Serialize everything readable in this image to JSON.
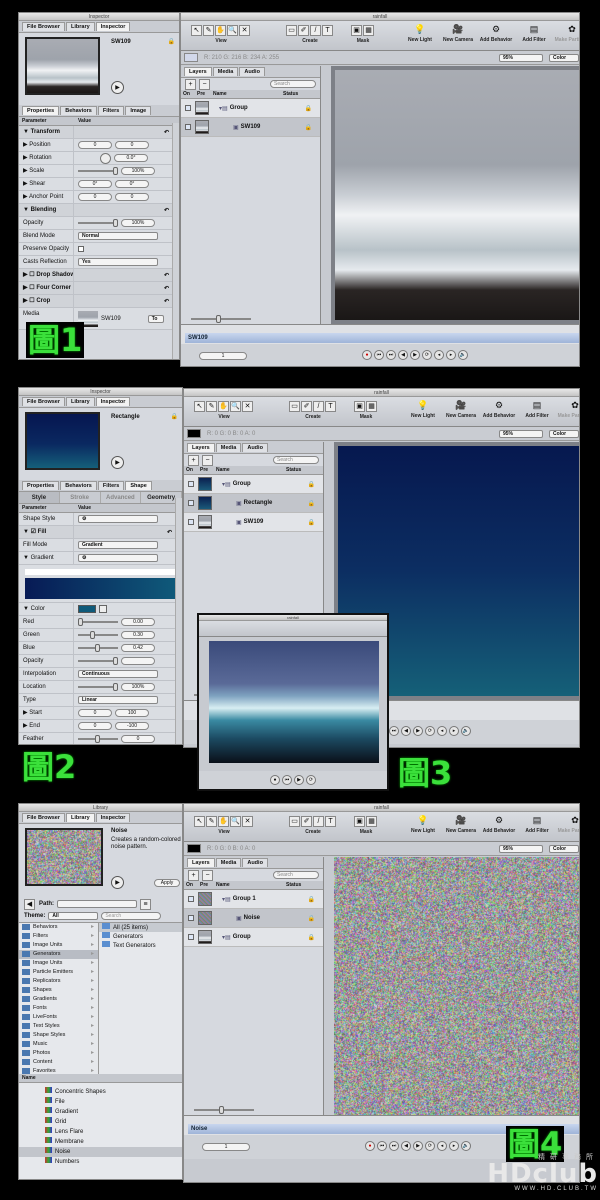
{
  "figure_labels": {
    "fig1": "圖1",
    "fig2": "圖2",
    "fig3": "圖3",
    "fig4": "圖4"
  },
  "watermark": {
    "brand": "HDclub",
    "subtitle": "精研事務所",
    "url": "WWW.HD.CLUB.TW"
  },
  "window": {
    "title": "rainfall",
    "tool_groups": [
      "View",
      "Create",
      "Mask"
    ],
    "actions": [
      "New Light",
      "New Camera",
      "Add Behavior",
      "Add Filter",
      "Make Particles"
    ],
    "zoom": "95%",
    "view_mode": "Color",
    "tabs": [
      "Layers",
      "Media",
      "Audio"
    ],
    "search_placeholder": "Search",
    "columns": [
      "On",
      "Pre",
      "Name",
      "Status"
    ],
    "frame": "1"
  },
  "fig1": {
    "inspector": {
      "title": "Inspector",
      "tabs": [
        "File Browser",
        "Library",
        "Inspector"
      ],
      "preview_name": "SW109",
      "subtabs": [
        "Properties",
        "Behaviors",
        "Filters",
        "Image"
      ],
      "header": [
        "Parameter",
        "Value"
      ],
      "rows": [
        {
          "label": "▼ Transform",
          "kind": "sec",
          "values": []
        },
        {
          "label": "▶ Position",
          "kind": "pair",
          "values": [
            "0",
            "0"
          ]
        },
        {
          "label": "▶ Rotation",
          "kind": "dial",
          "values": [
            "0.0°"
          ]
        },
        {
          "label": "▶ Scale",
          "kind": "slider",
          "values": [
            "100%"
          ]
        },
        {
          "label": "▶ Shear",
          "kind": "pair",
          "values": [
            "0°",
            "0°"
          ]
        },
        {
          "label": "▶ Anchor Point",
          "kind": "pair",
          "values": [
            "0",
            "0"
          ]
        },
        {
          "label": "▼ Blending",
          "kind": "sec",
          "values": []
        },
        {
          "label": "Opacity",
          "kind": "slider",
          "values": [
            "100%"
          ]
        },
        {
          "label": "Blend Mode",
          "kind": "select",
          "values": [
            "Normal"
          ]
        },
        {
          "label": "Preserve Opacity",
          "kind": "check",
          "values": []
        },
        {
          "label": "Casts Reflection",
          "kind": "select",
          "values": [
            "Yes"
          ]
        },
        {
          "label": "▶ ☐ Drop Shadow",
          "kind": "sec",
          "values": []
        },
        {
          "label": "▶ ☐ Four Corner",
          "kind": "sec",
          "values": []
        },
        {
          "label": "▶ ☐ Crop",
          "kind": "sec",
          "values": []
        },
        {
          "label": "Media",
          "kind": "media",
          "values": [
            "SW109",
            "To"
          ]
        }
      ]
    },
    "color_readout": "R: 210  G: 216  B: 234  A: 255",
    "layers": [
      {
        "name": "Group",
        "level": 0,
        "selected": false
      },
      {
        "name": "SW109",
        "level": 1,
        "selected": true
      }
    ],
    "track": "SW109"
  },
  "fig2": {
    "inspector": {
      "title": "Inspector",
      "tabs": [
        "File Browser",
        "Library",
        "Inspector"
      ],
      "preview_name": "Rectangle",
      "subtabs": [
        "Properties",
        "Behaviors",
        "Filters",
        "Shape"
      ],
      "shape_tabs": [
        "Style",
        "Stroke",
        "Advanced",
        "Geometry"
      ],
      "header": [
        "Parameter",
        "Value"
      ],
      "rows": [
        {
          "label": "Shape Style",
          "kind": "select",
          "values": [
            "⚙"
          ]
        },
        {
          "label": "▼ ☑ Fill",
          "kind": "sec",
          "values": []
        },
        {
          "label": "Fill Mode",
          "kind": "select",
          "values": [
            "Gradient"
          ]
        },
        {
          "label": "▼ Gradient",
          "kind": "select",
          "values": [
            "⚙"
          ]
        },
        {
          "label": "",
          "kind": "gradient",
          "values": []
        },
        {
          "label": "▼ Color",
          "kind": "color",
          "values": []
        },
        {
          "label": "Red",
          "kind": "slider",
          "values": [
            "0.00"
          ]
        },
        {
          "label": "Green",
          "kind": "slider",
          "values": [
            "0.30"
          ]
        },
        {
          "label": "Blue",
          "kind": "slider",
          "values": [
            "0.42"
          ]
        },
        {
          "label": "Opacity",
          "kind": "slider",
          "values": [
            ""
          ]
        },
        {
          "label": "Interpolation",
          "kind": "select",
          "values": [
            "Continuous"
          ]
        },
        {
          "label": "Location",
          "kind": "slider",
          "values": [
            "100%"
          ]
        },
        {
          "label": "Type",
          "kind": "select",
          "values": [
            "Linear"
          ]
        },
        {
          "label": "▶ Start",
          "kind": "pair",
          "values": [
            "0",
            "100"
          ]
        },
        {
          "label": "▶ End",
          "kind": "pair",
          "values": [
            "0",
            "-100"
          ]
        },
        {
          "label": "Feather",
          "kind": "slider",
          "values": [
            "0"
          ]
        }
      ]
    },
    "color_readout": "R: 0   G: 0   B: 0   A: 0",
    "layers": [
      {
        "name": "Group",
        "level": 0,
        "selected": false
      },
      {
        "name": "Rectangle",
        "level": 1,
        "selected": true
      },
      {
        "name": "SW109",
        "level": 1,
        "selected": false
      }
    ]
  },
  "fig4": {
    "library": {
      "title": "Library",
      "tabs": [
        "File Browser",
        "Library",
        "Inspector"
      ],
      "item_name": "Noise",
      "description": "Creates a random-colored noise pattern.",
      "apply": "Apply",
      "path_label": "Path:",
      "theme_label": "Theme:",
      "theme_value": "All",
      "search_placeholder": "Search",
      "categories": [
        "Behaviors",
        "Filters",
        "Image Units",
        "Generators",
        "Image Units",
        "Particle Emitters",
        "Replicators",
        "Shapes",
        "Gradients",
        "Fonts",
        "LiveFonts",
        "Text Styles",
        "Shape Styles",
        "Music",
        "Photos",
        "Content",
        "Favorites"
      ],
      "selected_category": "Generators",
      "folders": [
        "All (25 items)",
        "Generators",
        "Text Generators"
      ],
      "list_header": "Name",
      "items": [
        "Concentric Shapes",
        "File",
        "Gradient",
        "Grid",
        "Lens Flare",
        "Membrane",
        "Noise",
        "Numbers"
      ],
      "selected_item": "Noise"
    },
    "color_readout": "R: 0   G: 0   B: 0   A: 0",
    "layers": [
      {
        "name": "Group 1",
        "level": 0,
        "selected": false
      },
      {
        "name": "Noise",
        "level": 1,
        "selected": true
      },
      {
        "name": "Group",
        "level": 0,
        "selected": false
      }
    ],
    "track": "Noise"
  },
  "fig3": {
    "title": "rainfall"
  }
}
